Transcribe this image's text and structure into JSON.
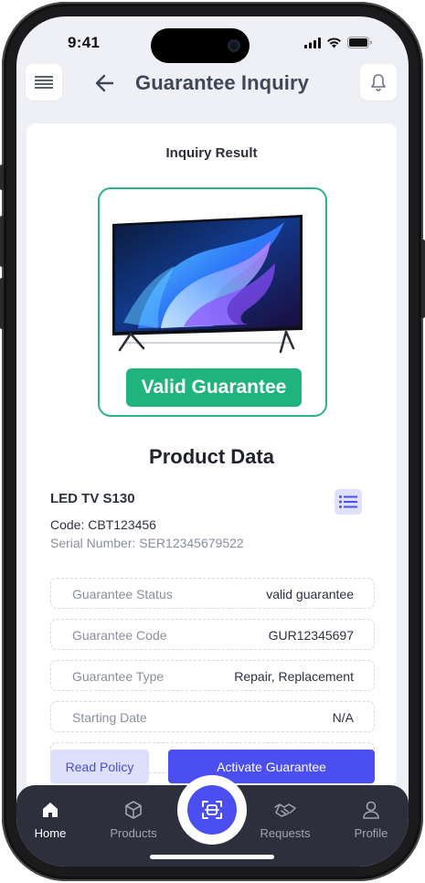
{
  "status_bar": {
    "time": "9:41"
  },
  "header": {
    "title": "Guarantee Inquiry",
    "menu_icon": "hamburger-menu-icon",
    "back_icon": "arrow-left-icon",
    "bell_icon": "bell-icon"
  },
  "result": {
    "title": "Inquiry Result",
    "badge": "Valid Guarantee",
    "badge_color": "#1fb37e",
    "frame_color": "#28b487"
  },
  "product": {
    "section_title": "Product Data",
    "name": "LED TV S130",
    "code": "Code: CBT123456",
    "serial": "Serial Number: SER12345679522",
    "details": [
      {
        "label": "Guarantee Status",
        "value": "valid guarantee"
      },
      {
        "label": "Guarantee Code",
        "value": "GUR12345697"
      },
      {
        "label": "Guarantee Type",
        "value": "Repair, Replacement"
      },
      {
        "label": "Starting Date",
        "value": "N/A"
      }
    ]
  },
  "actions": {
    "read_policy": "Read Policy",
    "activate": "Activate Guarantee",
    "accent": "#4b4ef0"
  },
  "nav": {
    "items": [
      {
        "label": "Home",
        "icon": "home-icon"
      },
      {
        "label": "Products",
        "icon": "box-icon"
      },
      {
        "label": "Requests",
        "icon": "handshake-icon"
      },
      {
        "label": "Profile",
        "icon": "user-icon"
      }
    ],
    "scan_icon": "scan-icon"
  }
}
